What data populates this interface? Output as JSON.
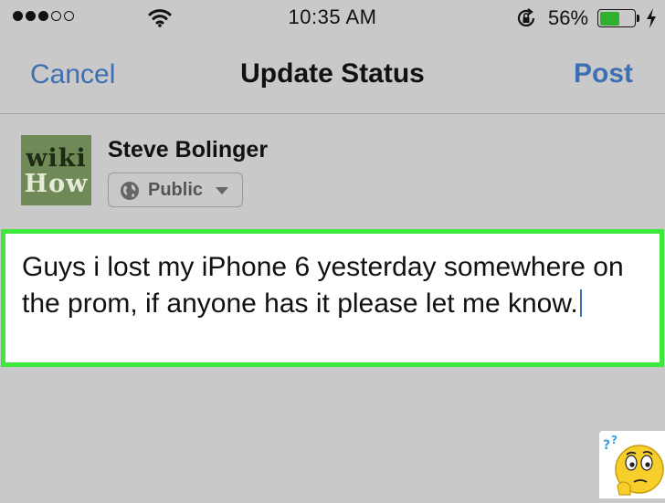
{
  "status_bar": {
    "time": "10:35 AM",
    "battery_percent": "56%",
    "battery_level": 0.56,
    "signal_bars_filled": 3,
    "signal_bars_total": 5,
    "battery_color": "#2fb12f"
  },
  "nav": {
    "cancel_label": "Cancel",
    "title": "Update Status",
    "post_label": "Post",
    "accent_color": "#3e6fb3"
  },
  "composer": {
    "avatar_line1": "wiki",
    "avatar_line2": "How",
    "user_name": "Steve Bolinger",
    "audience_label": "Public",
    "text": "Guys i lost my iPhone 6 yesterday somewhere on the prom, if anyone has it please let me know.",
    "highlight_color": "#3ee83e"
  },
  "icons": [
    "wifi-icon",
    "rotation-lock-icon",
    "battery-icon",
    "charging-bolt-icon",
    "globe-icon",
    "chevron-down-icon",
    "thinking-emoji-icon"
  ]
}
